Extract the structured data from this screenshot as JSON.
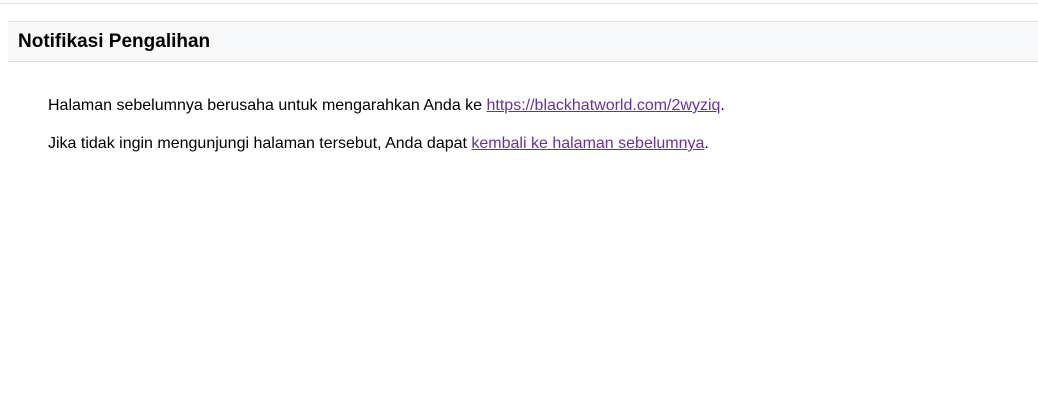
{
  "header": {
    "title": "Notifikasi Pengalihan"
  },
  "message": {
    "line1_text": "Halaman sebelumnya berusaha untuk mengarahkan Anda ke ",
    "line1_link": "https://blackhatworld.com/2wyziq",
    "line1_end": ".",
    "line2_text": "Jika tidak ingin mengunjungi halaman tersebut, Anda dapat ",
    "line2_link": "kembali ke halaman sebelumnya",
    "line2_end": "."
  },
  "colors": {
    "link": "#6b2ea8",
    "header_bg": "#f8f9fa"
  }
}
